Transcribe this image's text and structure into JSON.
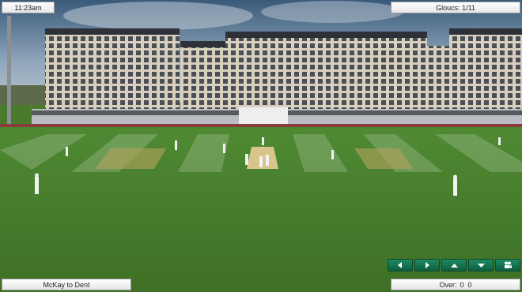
{
  "hud": {
    "time": "11:23am",
    "score": "Gloucs: 1/11",
    "bowler_batter": "McKay to Dent",
    "over_label": "Over:",
    "over_value": "0  0"
  },
  "camera_controls": [
    {
      "icon": "arrow-left-icon"
    },
    {
      "icon": "arrow-right-icon"
    },
    {
      "icon": "arrow-up-icon"
    },
    {
      "icon": "arrow-down-icon"
    },
    {
      "icon": "camera-icon"
    }
  ],
  "colors": {
    "grass": "#4a7a2c",
    "pitch": "#d8c58a",
    "button_green": "#138256"
  }
}
